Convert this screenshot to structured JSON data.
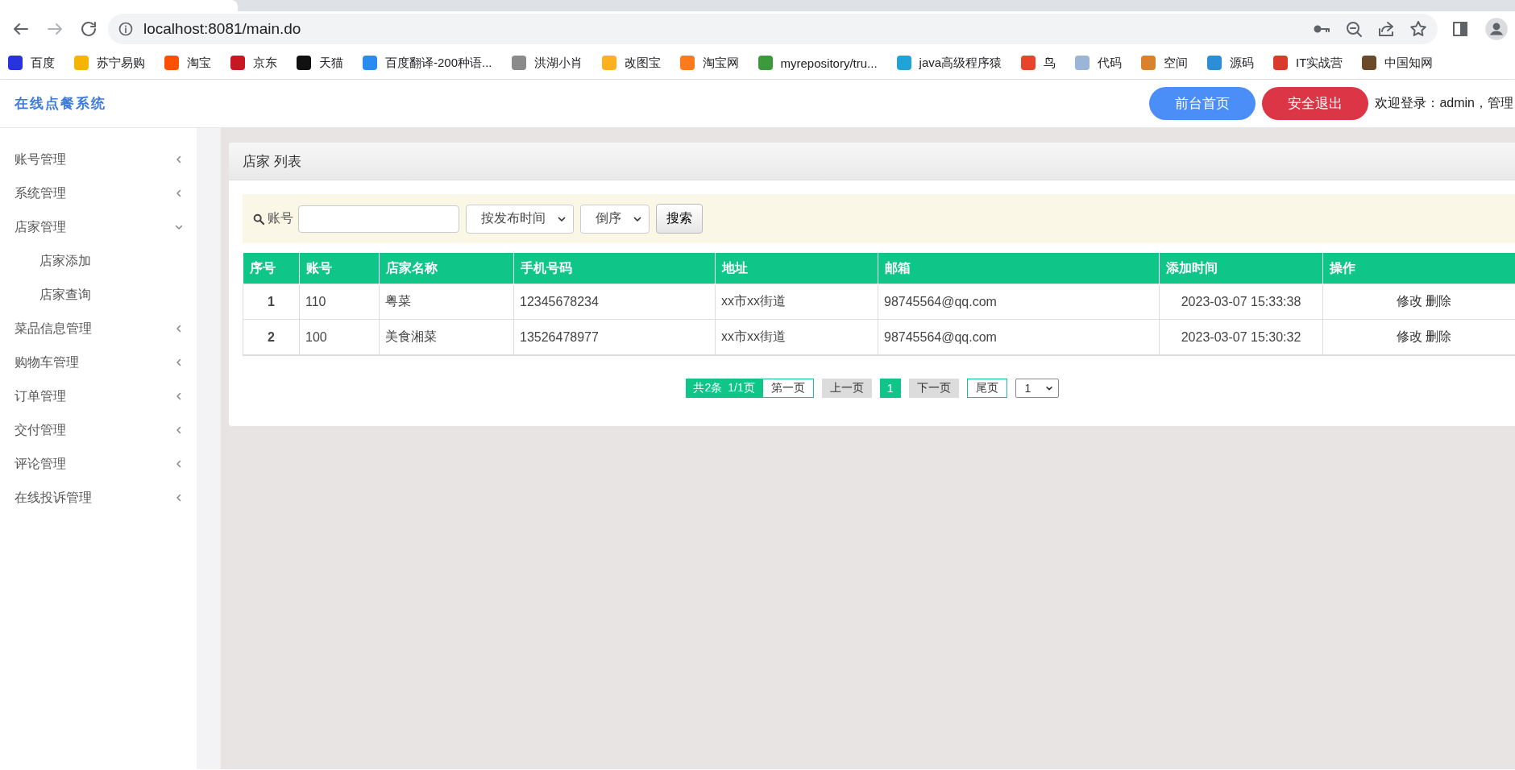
{
  "browser": {
    "address": "localhost:8081/main.do",
    "bookmarks": [
      {
        "label": "百度",
        "color": "#2932e1"
      },
      {
        "label": "苏宁易购",
        "color": "#f5b400"
      },
      {
        "label": "淘宝",
        "color": "#ff5000"
      },
      {
        "label": "京东",
        "color": "#c91623"
      },
      {
        "label": "天猫",
        "color": "#111111"
      },
      {
        "label": "百度翻译-200种语...",
        "color": "#2a8cf0"
      },
      {
        "label": "洪湖小肖",
        "color": "#8a8a8a"
      },
      {
        "label": "改图宝",
        "color": "#ffb01f"
      },
      {
        "label": "淘宝网",
        "color": "#ff7a1a"
      },
      {
        "label": "myrepository/tru...",
        "color": "#3d9a3a"
      },
      {
        "label": "java高级程序猿",
        "color": "#20a4d8"
      },
      {
        "label": "鸟",
        "color": "#e8432b"
      },
      {
        "label": "代码",
        "color": "#9ab5d6"
      },
      {
        "label": "空间",
        "color": "#d9822b"
      },
      {
        "label": "源码",
        "color": "#2c8fd6"
      },
      {
        "label": "IT实战营",
        "color": "#d93a2b"
      },
      {
        "label": "中国知网",
        "color": "#6b4a2a"
      }
    ]
  },
  "header": {
    "title": "在线点餐系统",
    "buttons": [
      {
        "label": "前台首页",
        "kind": "primary"
      },
      {
        "label": "安全退出",
        "kind": "danger"
      }
    ],
    "welcome": "欢迎登录：admin，管理"
  },
  "sidebar": {
    "items": [
      {
        "label": "账号管理",
        "expanded": false
      },
      {
        "label": "系统管理",
        "expanded": false
      },
      {
        "label": "店家管理",
        "expanded": true,
        "children": [
          {
            "label": "店家添加"
          },
          {
            "label": "店家查询"
          }
        ]
      },
      {
        "label": "菜品信息管理",
        "expanded": false
      },
      {
        "label": "购物车管理",
        "expanded": false
      },
      {
        "label": "订单管理",
        "expanded": false
      },
      {
        "label": "交付管理",
        "expanded": false
      },
      {
        "label": "评论管理",
        "expanded": false
      },
      {
        "label": "在线投诉管理",
        "expanded": false
      }
    ]
  },
  "panel": {
    "title": "店家 列表",
    "search": {
      "label": "账号",
      "sort": "按发布时间",
      "order": "倒序",
      "button": "搜索"
    },
    "table": {
      "columns": [
        "序号",
        "账号",
        "店家名称",
        "手机号码",
        "地址",
        "邮箱",
        "添加时间",
        "操作"
      ],
      "rows": [
        {
          "cells": [
            "1",
            "110",
            "粤菜",
            "12345678234",
            "xx市xx街道",
            "98745564@qq.com",
            "2023-03-07 15:33:38"
          ],
          "actions": [
            "修改",
            "删除"
          ]
        },
        {
          "cells": [
            "2",
            "100",
            "美食湘菜",
            "13526478977",
            "xx市xx街道",
            "98745564@qq.com",
            "2023-03-07 15:30:32"
          ],
          "actions": [
            "修改",
            "删除"
          ]
        }
      ]
    },
    "pagination": {
      "total": "共2条",
      "pages_info": "1/1页",
      "first": "第一页",
      "prev": "上一页",
      "pages": [
        {
          "label": "1",
          "selected": true
        }
      ],
      "next": "下一页",
      "last": "尾页",
      "jump": "1"
    }
  }
}
